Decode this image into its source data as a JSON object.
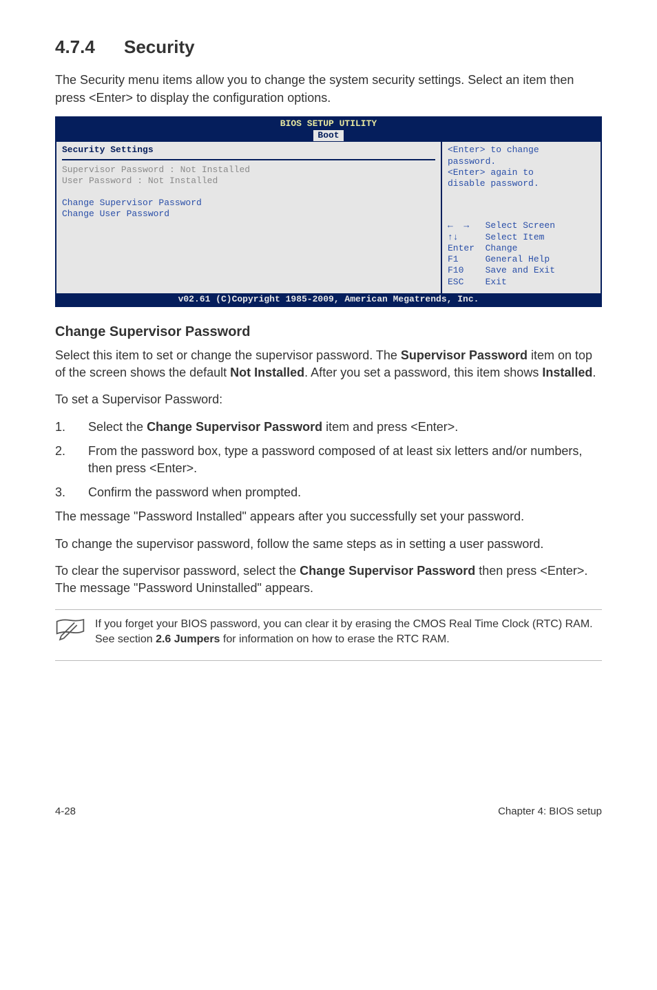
{
  "heading": {
    "number": "4.7.4",
    "title": "Security"
  },
  "intro": "The Security menu items allow you to change the system security settings. Select an item then press <Enter> to display the configuration options.",
  "bios": {
    "header_title": "BIOS SETUP UTILITY",
    "tab": "Boot",
    "left": {
      "section_title": "Security Settings",
      "supervisor_label": "Supervisor Password :",
      "supervisor_value": "Not Installed",
      "user_label": "User Password       :",
      "user_value": "Not Installed",
      "change_supervisor": "Change Supervisor Password",
      "change_user": "Change User Password"
    },
    "right_top": {
      "line1": "<Enter> to change",
      "line2": "password.",
      "line3": "<Enter> again to",
      "line4": "disable password."
    },
    "right_bottom": {
      "select_screen": "←  →   Select Screen",
      "select_item": "↑↓     Select Item",
      "enter_change": "Enter  Change",
      "f1": "F1     General Help",
      "f10": "F10    Save and Exit",
      "esc": "ESC    Exit"
    },
    "footer": "v02.61 (C)Copyright 1985-2009, American Megatrends, Inc."
  },
  "sub_heading": "Change Supervisor Password",
  "p1_a": "Select this item to set or change the supervisor password. The ",
  "p1_b": "Supervisor Password",
  "p1_c": " item on top of the screen shows the default ",
  "p1_d": "Not Installed",
  "p1_e": ". After you set a password, this item shows ",
  "p1_f": "Installed",
  "p1_g": ".",
  "p2": "To set a Supervisor Password:",
  "steps": {
    "s1a": "Select the ",
    "s1b": "Change Supervisor Password",
    "s1c": " item and press <Enter>.",
    "s2": "From the password box, type a password composed of at least six letters and/or numbers, then press <Enter>.",
    "s3": "Confirm the password when prompted."
  },
  "p3": "The message \"Password Installed\" appears after you successfully set your password.",
  "p4": "To change the supervisor password, follow the same steps as in setting a user password.",
  "p5a": "To clear the supervisor password, select the ",
  "p5b": "Change Supervisor Password",
  "p5c": " then press <Enter>. The message \"Password Uninstalled\" appears.",
  "note_a": "If you forget your BIOS password, you can clear it by erasing the CMOS Real Time Clock (RTC) RAM. See section ",
  "note_b": "2.6 Jumpers",
  "note_c": " for information on how to erase the RTC RAM.",
  "footer_left": "4-28",
  "footer_right": "Chapter 4: BIOS setup"
}
